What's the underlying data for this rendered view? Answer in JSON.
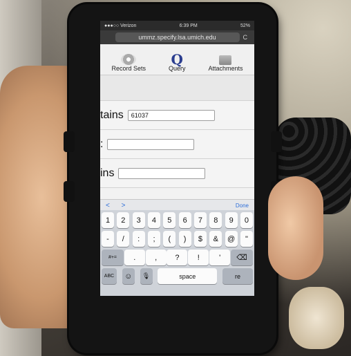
{
  "status": {
    "carrier": "●●●○○ Verizon",
    "time": "6:39 PM",
    "battery": "52%"
  },
  "url": "ummz.specify.lsa.umich.edu",
  "reload_glyph": "C",
  "nav": {
    "record_sets": "Record Sets",
    "query": "Query",
    "attachments": "Attachments",
    "query_glyph": "Q"
  },
  "rows": [
    {
      "label": "tains",
      "value": "61037"
    },
    {
      "label": ":",
      "value": ""
    },
    {
      "label": "ins",
      "value": ""
    }
  ],
  "toolbar": {
    "prev": "<",
    "next": ">",
    "done": "Done"
  },
  "keyboard": {
    "row1": [
      "1",
      "2",
      "3",
      "4",
      "5",
      "6",
      "7",
      "8",
      "9",
      "0"
    ],
    "row2": [
      "-",
      "/",
      ":",
      ";",
      "(",
      ")",
      "$",
      "&",
      "@",
      "\""
    ],
    "row3_left": "#+=",
    "row3": [
      ".",
      ",",
      "?",
      "!",
      "'"
    ],
    "row3_right": "⌫",
    "abc": "ABC",
    "emoji": "☺",
    "mic": "🎙",
    "space": "space",
    "return": "re"
  }
}
